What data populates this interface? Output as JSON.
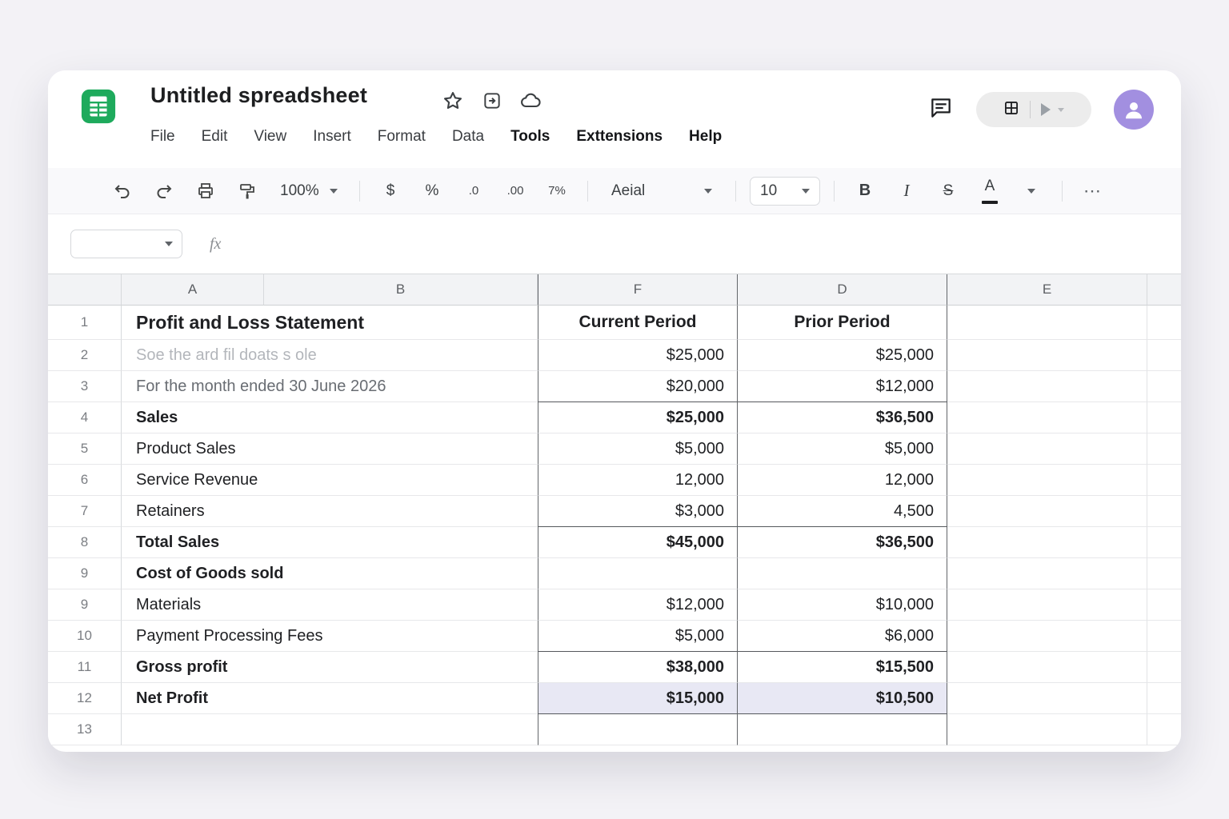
{
  "window": {
    "title": "Untitled spreadsheet"
  },
  "menu": {
    "items": [
      "File",
      "Edit",
      "View",
      "Insert",
      "Format",
      "Data",
      "Tools",
      "Exttensions",
      "Help"
    ]
  },
  "toolbar": {
    "zoom": "100%",
    "currency_label": "$",
    "percent_label": "%",
    "decrease_decimal_label": ".0",
    "increase_decimal_label": ".00",
    "number_format_label": "7%",
    "font_family_value": "Aeial",
    "font_size_value": "10",
    "bold_label": "B",
    "italic_label": "I",
    "strikethrough_label": "S",
    "text_color_label": "A",
    "more_label": "⋯"
  },
  "formula_bar": {
    "fx_label": "fx",
    "name_box_value": "",
    "input_value": ""
  },
  "grid": {
    "column_headers": [
      "A",
      "B",
      "F",
      "D",
      "E"
    ],
    "rows": [
      {
        "num": "1",
        "label": "Profit and Loss Statement",
        "current": "Current Period",
        "prior": "Prior Period",
        "style": "title"
      },
      {
        "num": "2",
        "label": "Soe the ard fil doats s ole",
        "current": "$25,000",
        "prior": "$25,000",
        "style": "faded"
      },
      {
        "num": "3",
        "label": "For the month ended 30 June 2026",
        "current": "$20,000",
        "prior": "$12,000",
        "style": "sub",
        "dark_bottom": true
      },
      {
        "num": "4",
        "label": "Sales",
        "current": "$25,000",
        "prior": "$36,500",
        "style": "bold"
      },
      {
        "num": "5",
        "label": "Product Sales",
        "current": "$5,000",
        "prior": "$5,000"
      },
      {
        "num": "6",
        "label": "Service Revenue",
        "current": "12,000",
        "prior": "12,000"
      },
      {
        "num": "7",
        "label": "Retainers",
        "current": "$3,000",
        "prior": "4,500",
        "dark_bottom": true
      },
      {
        "num": "8",
        "label": "Total Sales",
        "current": "$45,000",
        "prior": "$36,500",
        "style": "bold"
      },
      {
        "num": "9",
        "label": "Cost of Goods sold",
        "current": "",
        "prior": "",
        "style": "bold"
      },
      {
        "num": "9",
        "label": "Materials",
        "current": "$12,000",
        "prior": "$10,000"
      },
      {
        "num": "10",
        "label": "Payment Processing Fees",
        "current": "$5,000",
        "prior": "$6,000",
        "dark_bottom": true
      },
      {
        "num": "11",
        "label": "Gross profit",
        "current": "$38,000",
        "prior": "$15,500",
        "style": "bold"
      },
      {
        "num": "12",
        "label": "Net Profit",
        "current": "$15,000",
        "prior": "$10,500",
        "style": "bold",
        "highlight": true,
        "dark_bottom": true
      },
      {
        "num": "13",
        "label": "",
        "current": "",
        "prior": ""
      }
    ]
  },
  "colors": {
    "logo_green": "#1eaa5c",
    "avatar_purple": "#a28fe0",
    "highlight_lavender": "#e8e8f4"
  }
}
